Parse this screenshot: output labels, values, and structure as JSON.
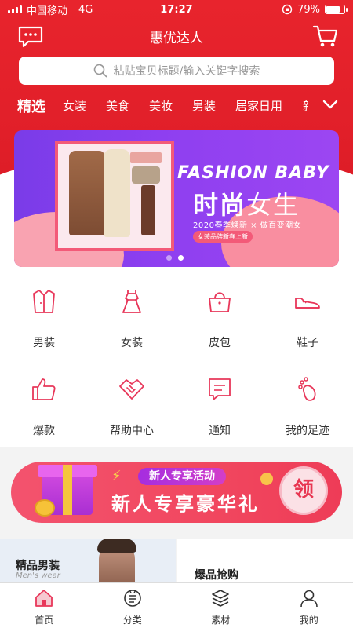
{
  "status_bar": {
    "carrier": "中国移动",
    "network": "4G",
    "time": "17:27",
    "battery": "79%",
    "battery_level": 0.79
  },
  "header": {
    "title": "惠优达人",
    "message_icon": "message-icon",
    "cart_icon": "cart-icon"
  },
  "search": {
    "placeholder": "粘贴宝贝标题/输入关键字搜索"
  },
  "tabs": [
    {
      "label": "精选",
      "active": true
    },
    {
      "label": "女装",
      "active": false
    },
    {
      "label": "美食",
      "active": false
    },
    {
      "label": "美妆",
      "active": false
    },
    {
      "label": "男装",
      "active": false
    },
    {
      "label": "居家日用",
      "active": false
    }
  ],
  "banner": {
    "headline_en": "FASHION BABY",
    "headline_cn_bold": "时尚",
    "headline_cn_light": "女生",
    "subline": "2020春季焕新 × 做百变潮女",
    "pill": "女装品牌新春上新",
    "slide_count": 2,
    "active_slide": 2
  },
  "grid": [
    {
      "label": "男装",
      "icon": "coat-icon"
    },
    {
      "label": "女装",
      "icon": "dress-icon"
    },
    {
      "label": "皮包",
      "icon": "handbag-icon"
    },
    {
      "label": "鞋子",
      "icon": "shoe-icon"
    },
    {
      "label": "爆款",
      "icon": "thumbs-up-icon"
    },
    {
      "label": "帮助中心",
      "icon": "handshake-icon"
    },
    {
      "label": "通知",
      "icon": "notice-icon"
    },
    {
      "label": "我的足迹",
      "icon": "footprint-icon"
    }
  ],
  "promo": {
    "tag": "新人专享活动",
    "headline": "新人专享豪华礼",
    "button": "领"
  },
  "cards": {
    "left_title": "精品男装",
    "left_sub": "Men's wear",
    "right_title": "爆品抢购"
  },
  "tabbar": [
    {
      "label": "首页",
      "icon": "home-icon",
      "active": true
    },
    {
      "label": "分类",
      "icon": "category-icon",
      "active": false
    },
    {
      "label": "素材",
      "icon": "layers-icon",
      "active": false
    },
    {
      "label": "我的",
      "icon": "profile-icon",
      "active": false
    }
  ],
  "colors": {
    "brand_red": "#e11f29",
    "accent_pink": "#e8375a"
  }
}
